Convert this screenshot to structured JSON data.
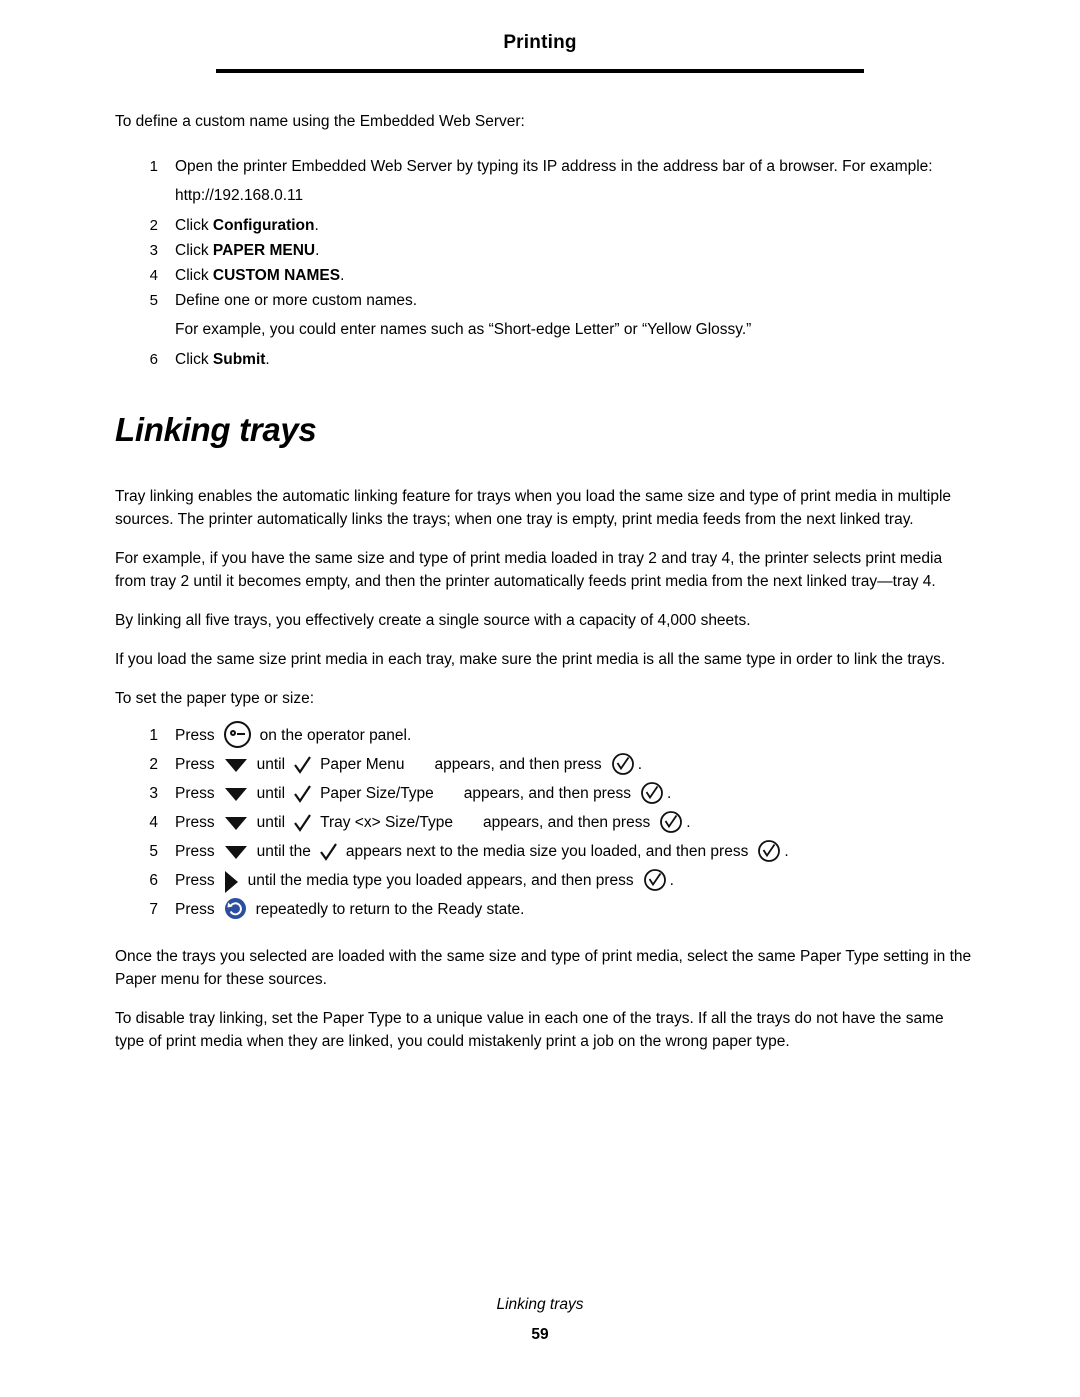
{
  "header": {
    "title": "Printing"
  },
  "intro": {
    "lead": "To define a custom name using the Embedded Web Server:"
  },
  "custom_name_steps": [
    {
      "num": "1",
      "text": "Open the printer Embedded Web Server by typing its IP address in the address bar of a browser. For example:",
      "sub": "http://192.168.0.11"
    },
    {
      "num": "2",
      "pre": "Click ",
      "bold": "Configuration",
      "post": "."
    },
    {
      "num": "3",
      "pre": "Click ",
      "bold": "PAPER MENU",
      "post": "."
    },
    {
      "num": "4",
      "pre": "Click ",
      "bold": "CUSTOM NAMES",
      "post": "."
    },
    {
      "num": "5",
      "text": "Define one or more custom names.",
      "sub": "For example, you could enter names such as “Short-edge Letter” or “Yellow Glossy.”"
    },
    {
      "num": "6",
      "pre": "Click ",
      "bold": "Submit",
      "post": "."
    }
  ],
  "section": {
    "title": "Linking trays",
    "paragraphs": [
      "Tray linking enables the automatic linking feature for trays when you load the same size and type of print media in multiple sources. The printer automatically links the trays; when one tray is empty, print media feeds from the next linked tray.",
      "For example, if you have the same size and type of print media loaded in tray 2 and tray 4, the printer selects print media from tray 2 until it becomes empty, and then the printer automatically feeds print media from the next linked tray—tray 4.",
      "By linking all five trays, you effectively create a single source with a capacity of 4,000 sheets.",
      "If you load the same size print media in each tray, make sure the print media is all the same type in order to link the trays.",
      "To set the paper type or size:"
    ]
  },
  "panel_steps": {
    "items": [
      {
        "num": "1",
        "parts": [
          {
            "t": "text",
            "v": "Press"
          },
          {
            "t": "icon",
            "v": "menu-key-icon"
          },
          {
            "t": "text",
            "v": "on the operator panel."
          }
        ]
      },
      {
        "num": "2",
        "parts": [
          {
            "t": "text",
            "v": "Press"
          },
          {
            "t": "icon",
            "v": "down-arrow-icon"
          },
          {
            "t": "text",
            "v": "until"
          },
          {
            "t": "icon",
            "v": "checkmark-icon"
          },
          {
            "t": "text",
            "v": "Paper Menu"
          },
          {
            "t": "text",
            "v": "appears, and then press"
          },
          {
            "t": "icon",
            "v": "select-icon"
          },
          {
            "t": "text",
            "v": "."
          }
        ]
      },
      {
        "num": "3",
        "parts": [
          {
            "t": "text",
            "v": "Press"
          },
          {
            "t": "icon",
            "v": "down-arrow-icon"
          },
          {
            "t": "text",
            "v": "until"
          },
          {
            "t": "icon",
            "v": "checkmark-icon"
          },
          {
            "t": "text",
            "v": "Paper Size/Type"
          },
          {
            "t": "text",
            "v": "appears, and then press"
          },
          {
            "t": "icon",
            "v": "select-icon"
          },
          {
            "t": "text",
            "v": "."
          }
        ]
      },
      {
        "num": "4",
        "parts": [
          {
            "t": "text",
            "v": "Press"
          },
          {
            "t": "icon",
            "v": "down-arrow-icon"
          },
          {
            "t": "text",
            "v": "until"
          },
          {
            "t": "icon",
            "v": "checkmark-icon"
          },
          {
            "t": "text",
            "v": "Tray <x> Size/Type"
          },
          {
            "t": "text",
            "v": "appears, and then press"
          },
          {
            "t": "icon",
            "v": "select-icon"
          },
          {
            "t": "text",
            "v": "."
          }
        ]
      },
      {
        "num": "5",
        "parts": [
          {
            "t": "text",
            "v": "Press"
          },
          {
            "t": "icon",
            "v": "down-arrow-icon"
          },
          {
            "t": "text",
            "v": "until the"
          },
          {
            "t": "icon",
            "v": "checkmark-icon"
          },
          {
            "t": "text",
            "v": "appears next to the media size you loaded, and then press"
          },
          {
            "t": "icon",
            "v": "select-icon"
          },
          {
            "t": "text",
            "v": "."
          }
        ]
      },
      {
        "num": "6",
        "parts": [
          {
            "t": "text",
            "v": "Press"
          },
          {
            "t": "icon",
            "v": "right-arrow-icon"
          },
          {
            "t": "text",
            "v": "until the media type you loaded appears, and then press"
          },
          {
            "t": "icon",
            "v": "select-icon"
          },
          {
            "t": "text",
            "v": "."
          }
        ]
      },
      {
        "num": "7",
        "parts": [
          {
            "t": "text",
            "v": "Press"
          },
          {
            "t": "icon",
            "v": "back-icon"
          },
          {
            "t": "text",
            "v": "repeatedly to return to the Ready state."
          }
        ]
      }
    ]
  },
  "closing": {
    "paragraphs": [
      "Once the trays you selected are loaded with the same size and type of print media, select the same Paper Type setting in the Paper menu for these sources.",
      "To disable tray linking, set the Paper Type to a unique value in each one of the trays. If all the trays do not have the same type of print media when they are linked, you could mistakenly print a job on the wrong paper type."
    ]
  },
  "footer": {
    "title": "Linking trays",
    "page": "59"
  },
  "colors": {
    "ink": "#000000",
    "back_icon_blue": "#2b4f9e"
  }
}
